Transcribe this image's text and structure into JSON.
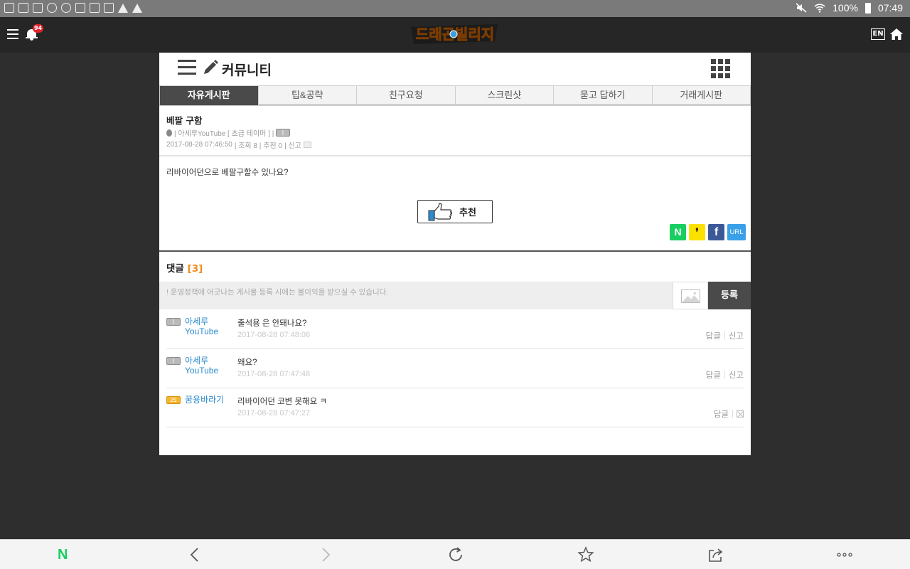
{
  "status_bar": {
    "battery": "100%",
    "time": "07:49"
  },
  "app_header": {
    "notification_count": "94",
    "logo_text": "드래곤빌리지",
    "lang_label": "EN"
  },
  "community": {
    "title": "커뮤니티"
  },
  "tabs": [
    {
      "label": "자유게시판",
      "active": true
    },
    {
      "label": "팁&공략",
      "active": false
    },
    {
      "label": "친구요청",
      "active": false
    },
    {
      "label": "스크린샷",
      "active": false
    },
    {
      "label": "묻고 답하기",
      "active": false
    },
    {
      "label": "거래게시판",
      "active": false
    }
  ],
  "post": {
    "title": "베팔 구함",
    "author_info": "| 아세루YouTube [ 초급 테이머 ] |",
    "date": "2017-08-28 07:46:50",
    "views": "| 조회 8 |",
    "recommends": "추천 0",
    "report": "| 신고",
    "body": "리바이어던으로 베팔구할수 있나요?",
    "recommend_button": "추천"
  },
  "share": {
    "naver": "N",
    "kakao": "❜",
    "facebook": "f",
    "url": "URL"
  },
  "comments_section": {
    "label": "댓글",
    "count": "[3]",
    "placeholder": "! 운영정책에 어긋나는 게시물 등록 시에는 불이익을 받으실 수 있습니다.",
    "submit": "등록"
  },
  "comments": [
    {
      "badge": "ᛒ",
      "badge_type": "grey",
      "user": "아세루YouTube",
      "text": "출석용 은 안돼나요?",
      "time": "2017-08-28 07:48:06",
      "reply": "답글",
      "report": "신고"
    },
    {
      "badge": "ᛒ",
      "badge_type": "grey",
      "user": "아세루YouTube",
      "text": "왜요?",
      "time": "2017-08-28 07:47:48",
      "reply": "답글",
      "report": "신고"
    },
    {
      "badge": "25",
      "badge_type": "gold",
      "user": "꿈용바라기",
      "text": "리바이어던 코변 못해요 ㅋ",
      "time": "2017-08-28 07:47:27",
      "reply": "답글",
      "report": ""
    }
  ],
  "colors": {
    "accent_count": "#f08c1a",
    "user_link": "#2c8ccd",
    "naver_green": "#19ce60",
    "active_tab": "#4a4a4a"
  }
}
